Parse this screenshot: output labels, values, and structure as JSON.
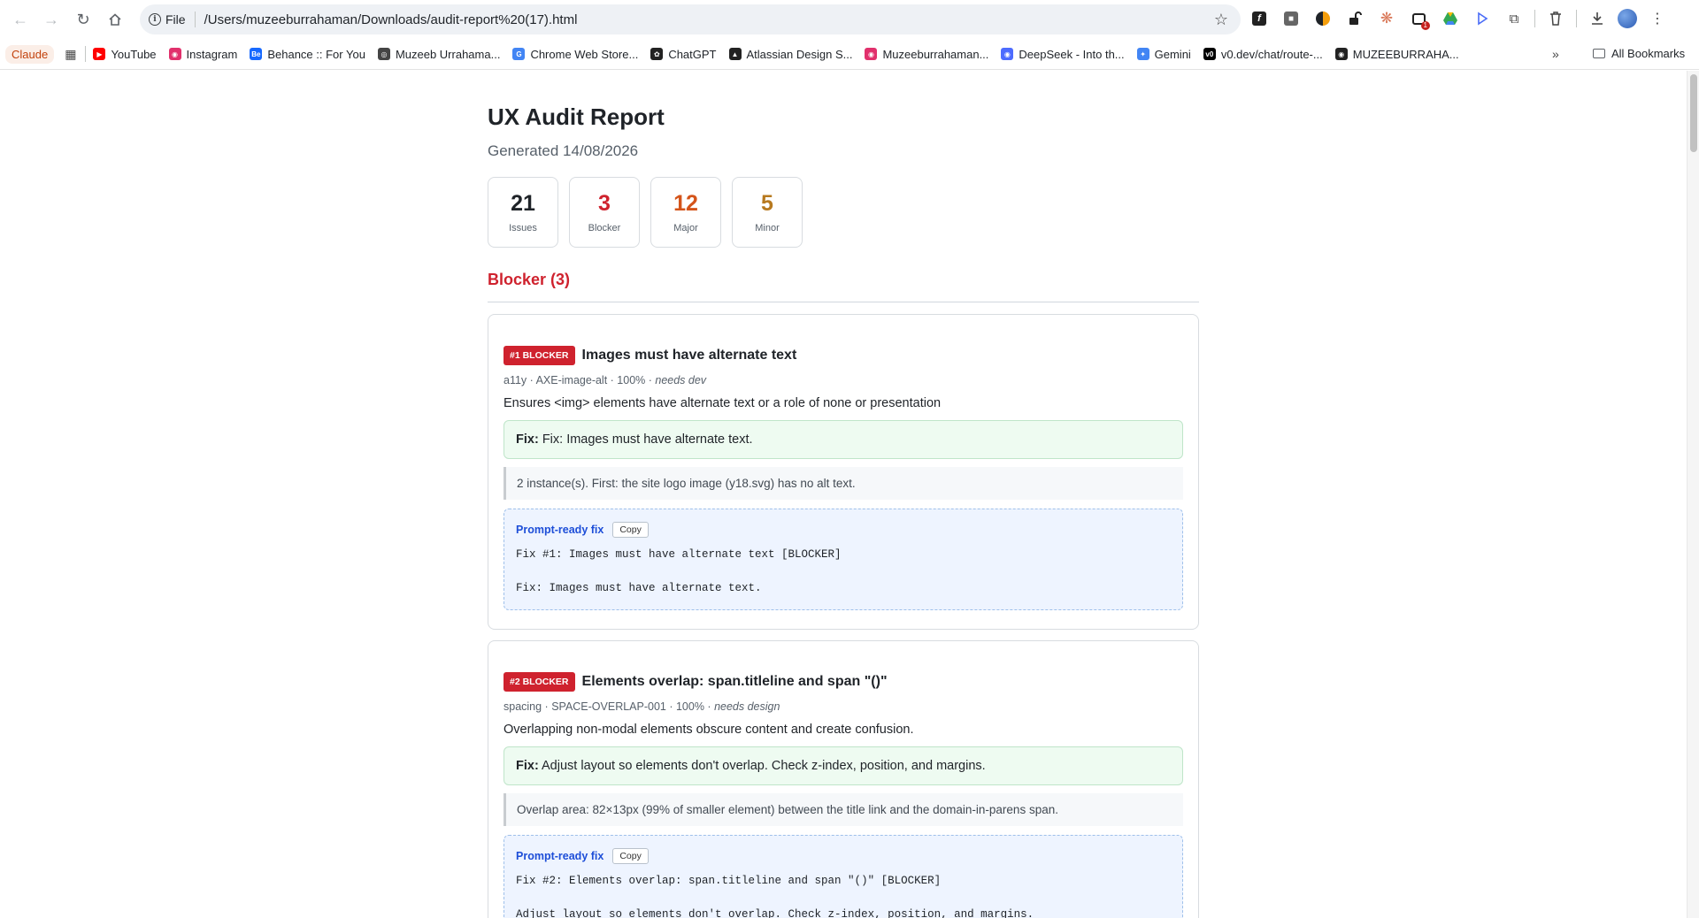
{
  "browser": {
    "site_chip": "File",
    "url": "/Users/muzeeburrahaman/Downloads/audit-report%20(17).html",
    "extension_badge": "1",
    "bookmarks": {
      "claude": "Claude",
      "items": [
        {
          "label": "YouTube",
          "icon": "youtube-icon",
          "color": "#ff0000"
        },
        {
          "label": "Instagram",
          "icon": "instagram-icon",
          "color": "#e1306c"
        },
        {
          "label": "Behance :: For You",
          "icon": "behance-icon",
          "color": "#1769ff"
        },
        {
          "label": "Muzeeb Urrahama...",
          "icon": "globe-icon",
          "color": "#444444"
        },
        {
          "label": "Chrome Web Store...",
          "icon": "google-icon",
          "color": "#4285f4"
        },
        {
          "label": "ChatGPT",
          "icon": "chatgpt-icon",
          "color": "#222222"
        },
        {
          "label": "Atlassian Design S...",
          "icon": "atlassian-icon",
          "color": "#222222"
        },
        {
          "label": "Muzeeburrahaman...",
          "icon": "instagram-icon",
          "color": "#e1306c"
        },
        {
          "label": "DeepSeek - Into th...",
          "icon": "deepseek-icon",
          "color": "#4d6bfe"
        },
        {
          "label": "Gemini",
          "icon": "gemini-icon",
          "color": "#4285f4"
        },
        {
          "label": "v0.dev/chat/route-...",
          "icon": "v0-icon",
          "color": "#000000"
        },
        {
          "label": "MUZEEBURRAHA...",
          "icon": "github-icon",
          "color": "#222222"
        }
      ],
      "all_bookmarks": "All Bookmarks"
    }
  },
  "report": {
    "title": "UX Audit Report",
    "generated": "Generated 14/08/2026",
    "stats": [
      {
        "value": "21",
        "label": "Issues",
        "color": "#1f2328"
      },
      {
        "value": "3",
        "label": "Blocker",
        "color": "#cf222e"
      },
      {
        "value": "12",
        "label": "Major",
        "color": "#d4541a"
      },
      {
        "value": "5",
        "label": "Minor",
        "color": "#b7791f"
      }
    ],
    "section_heading": "Blocker (3)",
    "issues": [
      {
        "badge": "#1 BLOCKER",
        "title": "Images must have alternate text",
        "meta_prefix": "a11y · AXE-image-alt · 100% · ",
        "meta_status": "needs dev",
        "description": "Ensures <img> elements have alternate text or a role of none or presentation",
        "fix_label": "Fix:",
        "fix_text": "Fix: Images must have alternate text.",
        "evidence": "2 instance(s). First: the site logo image (y18.svg) has no alt text.",
        "prompt_title": "Prompt-ready fix",
        "copy_label": "Copy",
        "prompt_line1": "Fix #1: Images must have alternate text [BLOCKER]",
        "prompt_line2": "Fix: Images must have alternate text."
      },
      {
        "badge": "#2 BLOCKER",
        "title": "Elements overlap: span.titleline and span \"()\"",
        "meta_prefix": "spacing · SPACE-OVERLAP-001 · 100% · ",
        "meta_status": "needs design",
        "description": "Overlapping non-modal elements obscure content and create confusion.",
        "fix_label": "Fix:",
        "fix_text": "Adjust layout so elements don't overlap. Check z-index, position, and margins.",
        "evidence": "Overlap area: 82×13px (99% of smaller element) between the title link and the domain-in-parens span.",
        "prompt_title": "Prompt-ready fix",
        "copy_label": "Copy",
        "prompt_line1": "Fix #2: Elements overlap: span.titleline and span \"()\" [BLOCKER]",
        "prompt_line2": "Adjust layout so elements don't overlap. Check z-index, position, and margins."
      }
    ]
  }
}
